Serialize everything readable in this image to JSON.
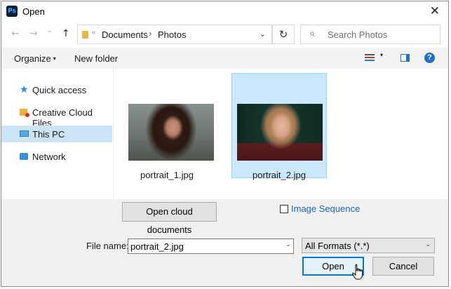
{
  "window": {
    "title": "Open",
    "app_icon": "Ps",
    "close_glyph": "✕"
  },
  "nav": {
    "back_glyph": "←",
    "forward_glyph": "→",
    "recent_glyph": "⌄",
    "up_glyph": "↑",
    "breadcrumb": [
      "Documents",
      "Photos"
    ],
    "breadcrumb_prefix": "«",
    "separator": "›",
    "dropdown_glyph": "⌄",
    "refresh_glyph": "↻",
    "search_placeholder": "Search Photos",
    "search_glyph": "⌕"
  },
  "toolbar": {
    "organize": "Organize",
    "new_folder": "New folder",
    "caret": "▾",
    "help": "?"
  },
  "sidebar": {
    "items": [
      {
        "label": "Quick access",
        "icon": "star-icon"
      },
      {
        "label": "Creative Cloud Files",
        "icon": "creative-cloud-folder-icon"
      },
      {
        "label": "This PC",
        "icon": "computer-icon",
        "selected": true
      },
      {
        "label": "Network",
        "icon": "network-icon"
      }
    ],
    "star_glyph": "★"
  },
  "files": [
    {
      "name": "portrait_1.jpg",
      "selected": false
    },
    {
      "name": "portrait_2.jpg",
      "selected": true
    }
  ],
  "bottom": {
    "cloud_button": "Open cloud documents",
    "image_sequence_label": "Image Sequence",
    "image_sequence_checked": false,
    "file_name_label": "File name:",
    "file_name_value": "portrait_2.jpg",
    "format_value": "All Formats (*.*)",
    "dropdown_glyph": "⌄",
    "open_button": "Open",
    "cancel_button": "Cancel"
  },
  "colors": {
    "accent": "#0078d7",
    "selection": "#cce8ff",
    "sidebar_selection": "#cce4f7",
    "link": "#1a66b8"
  }
}
